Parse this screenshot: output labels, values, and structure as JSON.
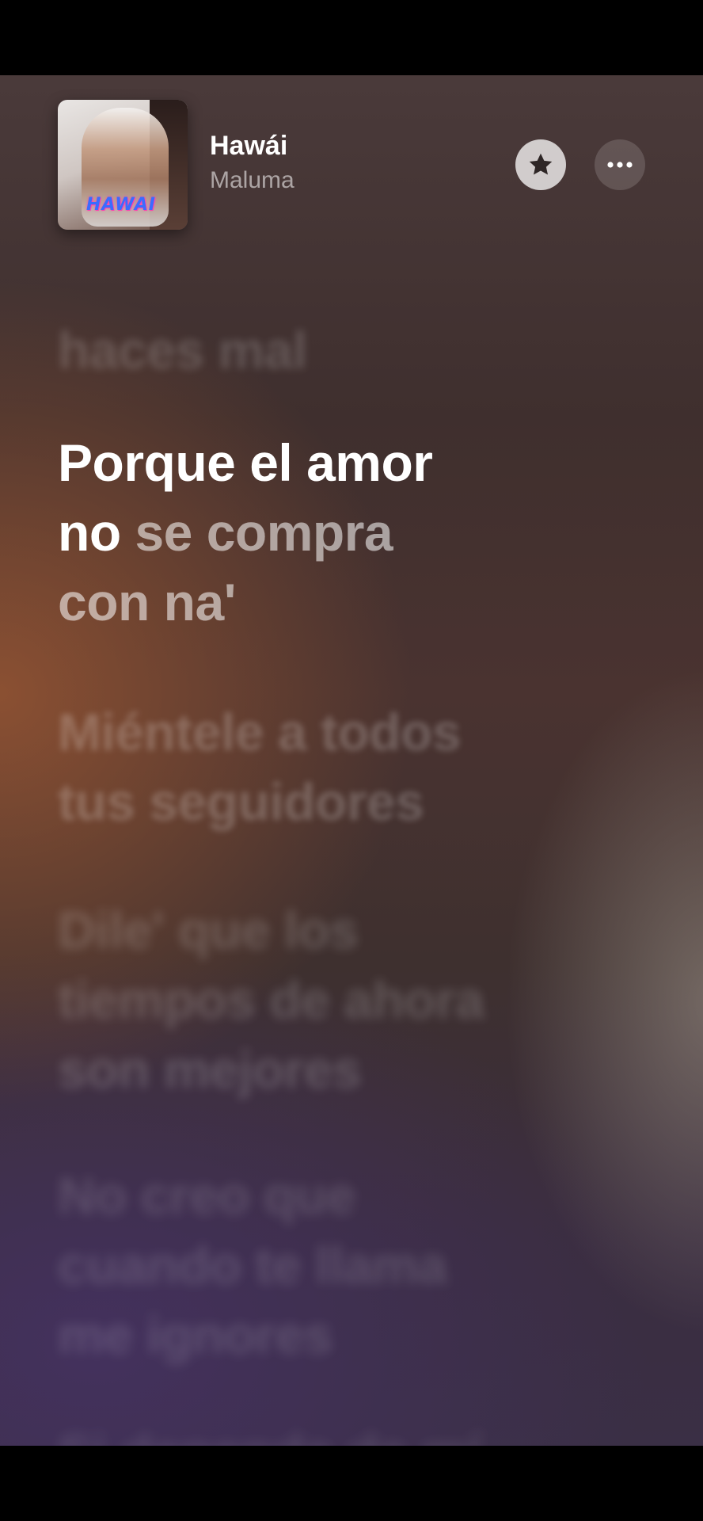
{
  "now_playing": {
    "title": "Hawái",
    "artist": "Maluma",
    "artwork_text": "HAWAI"
  },
  "actions": {
    "favorite_icon": "star-icon",
    "more_icon": "ellipsis-icon"
  },
  "lyrics": {
    "previous_line": "haces mal",
    "active": {
      "line1_sung": "Porque el amor",
      "line2_sung": "no",
      "line2_unsung": " se compra",
      "line3_unsung": "con na'"
    },
    "upcoming": [
      {
        "line1": "Miéntele a todos",
        "line2": "tus seguidores"
      },
      {
        "line1": "Dile' que los",
        "line2": "tiempos de ahora",
        "line3": "son mejores"
      },
      {
        "line1": "No creo que",
        "line2": "cuando te llama",
        "line3": "me ignores"
      },
      {
        "line1": "Si depende de mí"
      }
    ]
  },
  "colors": {
    "sung_text": "#ffffff",
    "accent_bg": "#3f2f2e"
  }
}
